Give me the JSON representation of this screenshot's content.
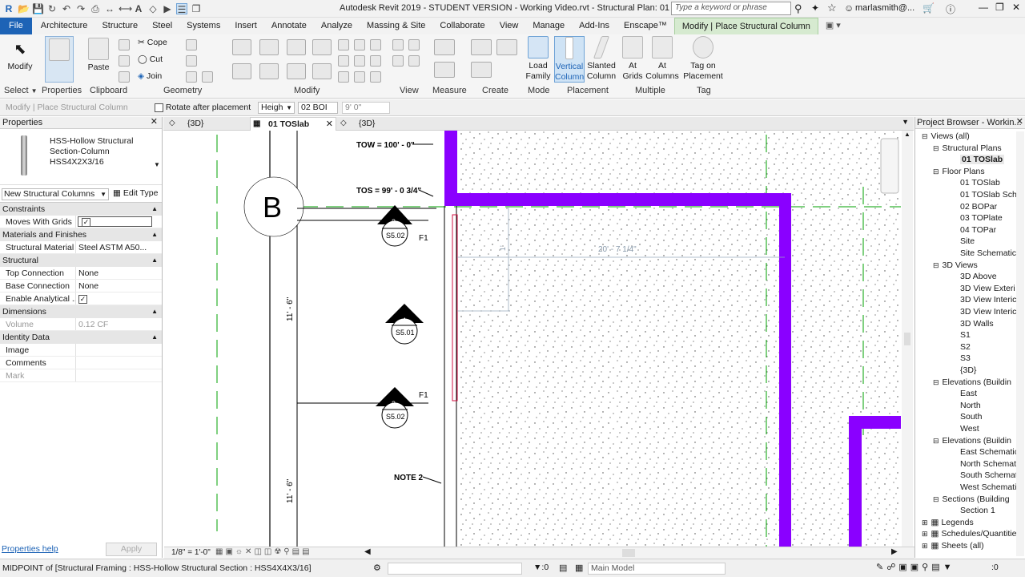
{
  "titlebar": {
    "title": "Autodesk Revit 2019 - STUDENT VERSION - Working Video.rvt - Structural Plan: 01 TOSlab",
    "search_placeholder": "Type a keyword or phrase",
    "user": "marlasmith@..."
  },
  "tabs": [
    "File",
    "Architecture",
    "Structure",
    "Steel",
    "Systems",
    "Insert",
    "Annotate",
    "Analyze",
    "Massing & Site",
    "Collaborate",
    "View",
    "Manage",
    "Add-Ins",
    "Enscape™",
    "Modify | Place Structural Column"
  ],
  "ribbon": {
    "modify": "Modify",
    "properties": "Properties",
    "paste": "Paste",
    "cope": "Cope",
    "cut": "Cut",
    "join": "Join",
    "load_family": [
      "Load",
      "Family"
    ],
    "vertical_column": [
      "Vertical",
      "Column"
    ],
    "slanted_column": [
      "Slanted",
      "Column"
    ],
    "at_grids": [
      "At",
      "Grids"
    ],
    "at_columns": [
      "At",
      "Columns"
    ],
    "tag_on_placement": [
      "Tag on",
      "Placement"
    ],
    "groups": {
      "select": "Select",
      "properties": "Properties",
      "clipboard": "Clipboard",
      "geometry": "Geometry",
      "modify": "Modify",
      "view": "View",
      "measure": "Measure",
      "create": "Create",
      "mode": "Mode",
      "placement": "Placement",
      "multiple": "Multiple",
      "tag": "Tag"
    }
  },
  "optionsbar": {
    "context": "Modify | Place Structural Column",
    "rotate": "Rotate after placement",
    "height_mode": "Heigh",
    "level": "02 BOI",
    "offset": "9'  0\""
  },
  "properties": {
    "title": "Properties",
    "type_name": "HSS-Hollow Structural Section-Column HSS4X2X3/16",
    "selector": "New Structural Columns",
    "edit_type": "Edit Type",
    "categories": {
      "constraints": "Constraints",
      "materials": "Materials and Finishes",
      "structural": "Structural",
      "dimensions": "Dimensions",
      "identity": "Identity Data"
    },
    "rows": {
      "moves_with_grids": "Moves With Grids",
      "structural_material": [
        "Structural Material",
        "Steel ASTM A50..."
      ],
      "top_connection": [
        "Top Connection",
        "None"
      ],
      "base_connection": [
        "Base Connection",
        "None"
      ],
      "enable_analytical": "Enable Analytical ...",
      "volume": [
        "Volume",
        "0.12 CF"
      ],
      "image": "Image",
      "comments": "Comments",
      "mark": "Mark"
    },
    "help": "Properties help",
    "apply": "Apply"
  },
  "viewtabs": {
    "t1": "{3D}",
    "t2": "01 TOSlab",
    "t3": "{3D}"
  },
  "drawing": {
    "grid_bubble": "B",
    "tow": "TOW = 100' - 0\"",
    "tos": "TOS = 99' - 0 3/4\"",
    "sec1_num": "3",
    "sec1_sheet": "S5.02",
    "sec2_num": "4",
    "sec2_sheet": "S5.01",
    "sec3_num": "3",
    "sec3_sheet": "S5.02",
    "f1a": "F1",
    "f1b": "F1",
    "dim_v1": "11' - 6\"",
    "dim_v2": "11' - 6\"",
    "dim_temp": "20' - 7 1/4\"",
    "dim_small": "1'",
    "note": "NOTE 2",
    "scale": "1/8\" = 1'-0\""
  },
  "project_browser": {
    "title": "Project Browser - Workin...",
    "items": [
      {
        "label": "Views (all)",
        "lvl": 0
      },
      {
        "label": "Structural Plans",
        "lvl": 1
      },
      {
        "label": "01 TOSlab",
        "lvl": 2,
        "bold": true
      },
      {
        "label": "Floor Plans",
        "lvl": 1
      },
      {
        "label": "01 TOSlab",
        "lvl": 2
      },
      {
        "label": "01 TOSlab Sch",
        "lvl": 2
      },
      {
        "label": "02 BOPar",
        "lvl": 2
      },
      {
        "label": "03 TOPlate",
        "lvl": 2
      },
      {
        "label": "04 TOPar",
        "lvl": 2
      },
      {
        "label": "Site",
        "lvl": 2
      },
      {
        "label": "Site Schematic",
        "lvl": 2
      },
      {
        "label": "3D Views",
        "lvl": 1
      },
      {
        "label": "3D Above",
        "lvl": 2
      },
      {
        "label": "3D View Exteri",
        "lvl": 2
      },
      {
        "label": "3D View Interic",
        "lvl": 2
      },
      {
        "label": "3D View Interic",
        "lvl": 2
      },
      {
        "label": "3D Walls",
        "lvl": 2
      },
      {
        "label": "S1",
        "lvl": 2
      },
      {
        "label": "S2",
        "lvl": 2
      },
      {
        "label": "S3",
        "lvl": 2
      },
      {
        "label": "{3D}",
        "lvl": 2
      },
      {
        "label": "Elevations (Buildin",
        "lvl": 1
      },
      {
        "label": "East",
        "lvl": 2
      },
      {
        "label": "North",
        "lvl": 2
      },
      {
        "label": "South",
        "lvl": 2
      },
      {
        "label": "West",
        "lvl": 2
      },
      {
        "label": "Elevations (Buildin",
        "lvl": 1
      },
      {
        "label": "East Schematic",
        "lvl": 2
      },
      {
        "label": "North Schemat",
        "lvl": 2
      },
      {
        "label": "South Schemat",
        "lvl": 2
      },
      {
        "label": "West Schemati",
        "lvl": 2
      },
      {
        "label": "Sections (Building",
        "lvl": 1
      },
      {
        "label": "Section 1",
        "lvl": 2
      },
      {
        "label": "Legends",
        "lvl": 0
      },
      {
        "label": "Schedules/Quantitie",
        "lvl": 0
      },
      {
        "label": "Sheets (all)",
        "lvl": 0
      }
    ]
  },
  "statusbar": {
    "text": "MIDPOINT  of [Structural Framing : HSS-Hollow Structural Section : HSS4X4X3/16]",
    "zero": ":0",
    "model": "Main Model"
  },
  "colors": {
    "accent": "#1d63b6",
    "wall": "#8a00ff",
    "grid": "#00a000"
  }
}
